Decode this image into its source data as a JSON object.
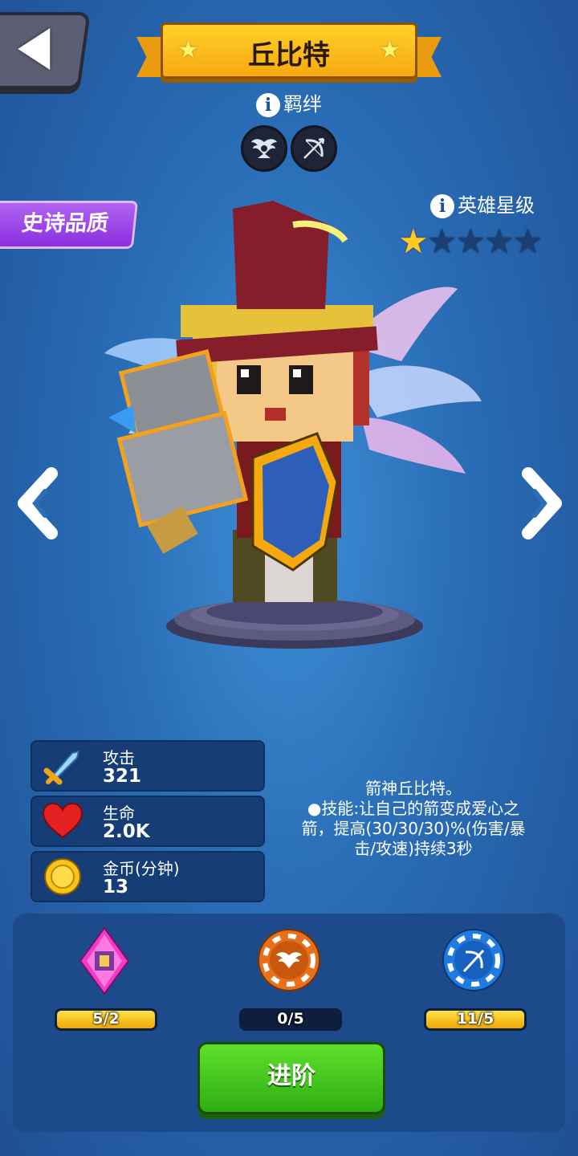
{
  "header": {
    "title": "丘比特"
  },
  "bond": {
    "label": "羁绊",
    "icons": [
      "winged-badge-icon",
      "bow-icon"
    ]
  },
  "quality": {
    "label": "史诗品质"
  },
  "star_level": {
    "label": "英雄星级",
    "filled": 1,
    "total": 5
  },
  "stats": [
    {
      "label": "攻击",
      "value": "321",
      "icon": "sword-icon"
    },
    {
      "label": "生命",
      "value": "2.0K",
      "icon": "heart-icon"
    },
    {
      "label": "金币(分钟)",
      "value": "13",
      "icon": "gold-coin-icon"
    }
  ],
  "skill": {
    "line1": "箭神丘比特。",
    "line2": "●技能:让自己的箭变成爱心之",
    "line3": "箭，提高(30/30/30)%(伤害/暴",
    "line4": "击/攻速)持续3秒"
  },
  "resources": [
    {
      "icon": "pink-gem-shard-icon",
      "text": "5/2",
      "fill": 1.0
    },
    {
      "icon": "orange-wing-chip-icon",
      "text": "0/5",
      "fill": 0.0
    },
    {
      "icon": "blue-bow-chip-icon",
      "text": "11/5",
      "fill": 1.0
    }
  ],
  "actions": {
    "advance": "进阶"
  },
  "colors": {
    "background": "#2a6fb8",
    "advance_button": "#3cc41a",
    "quality_tag": "#9b3fe8",
    "star_filled": "#ffc928"
  }
}
